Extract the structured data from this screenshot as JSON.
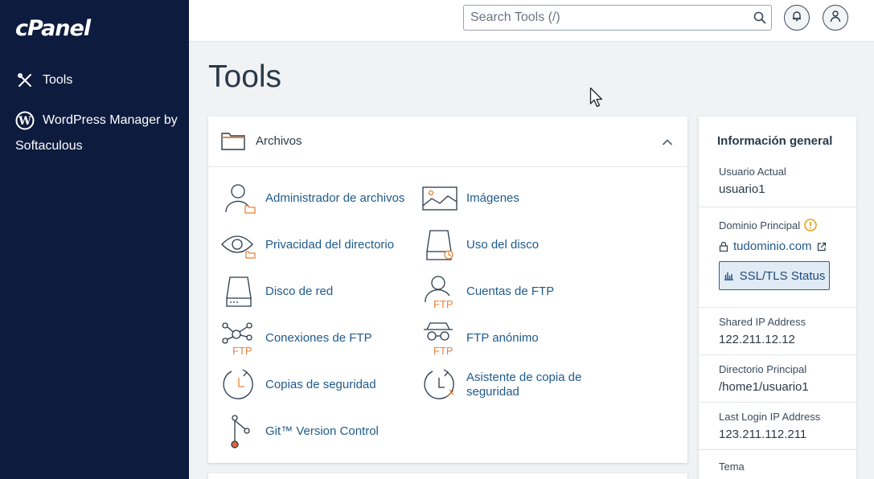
{
  "sidebar": {
    "logo": "cPanel",
    "items": [
      {
        "label": "Tools",
        "icon": "tools-icon"
      },
      {
        "label": "WordPress Manager by Softaculous",
        "icon": "wordpress-icon"
      }
    ]
  },
  "header": {
    "search_placeholder": "Search Tools (/)"
  },
  "page": {
    "title": "Tools"
  },
  "archivos": {
    "title": "Archivos",
    "tools": [
      {
        "label": "Administrador de archivos",
        "icon": "file-manager-icon"
      },
      {
        "label": "Imágenes",
        "icon": "images-icon"
      },
      {
        "label": "Privacidad del directorio",
        "icon": "directory-privacy-icon"
      },
      {
        "label": "Uso del disco",
        "icon": "disk-usage-icon"
      },
      {
        "label": "Disco de red",
        "icon": "network-disk-icon"
      },
      {
        "label": "Cuentas de FTP",
        "icon": "ftp-accounts-icon"
      },
      {
        "label": "Conexiones de FTP",
        "icon": "ftp-connections-icon"
      },
      {
        "label": "FTP anónimo",
        "icon": "anonymous-ftp-icon"
      },
      {
        "label": "Copias de seguridad",
        "icon": "backup-icon"
      },
      {
        "label": "Asistente de copia de seguridad",
        "icon": "backup-wizard-icon"
      },
      {
        "label": "Git™ Version Control",
        "icon": "git-icon"
      }
    ]
  },
  "info": {
    "title": "Información general",
    "current_user_label": "Usuario Actual",
    "current_user": "usuario1",
    "primary_domain_label": "Dominio Principal",
    "primary_domain": "tudominio.com",
    "ssl_button": "SSL/TLS Status",
    "shared_ip_label": "Shared IP Address",
    "shared_ip": "122.211.12.12",
    "home_dir_label": "Directorio Principal",
    "home_dir": "/home1/usuario1",
    "last_login_label": "Last Login IP Address",
    "last_login": "123.211.112.211",
    "theme_label": "Tema"
  },
  "colors": {
    "sidebar_bg": "#0d1b3e",
    "link": "#1f5a8c",
    "accent_orange": "#e8823a",
    "warning": "#e8a317"
  }
}
